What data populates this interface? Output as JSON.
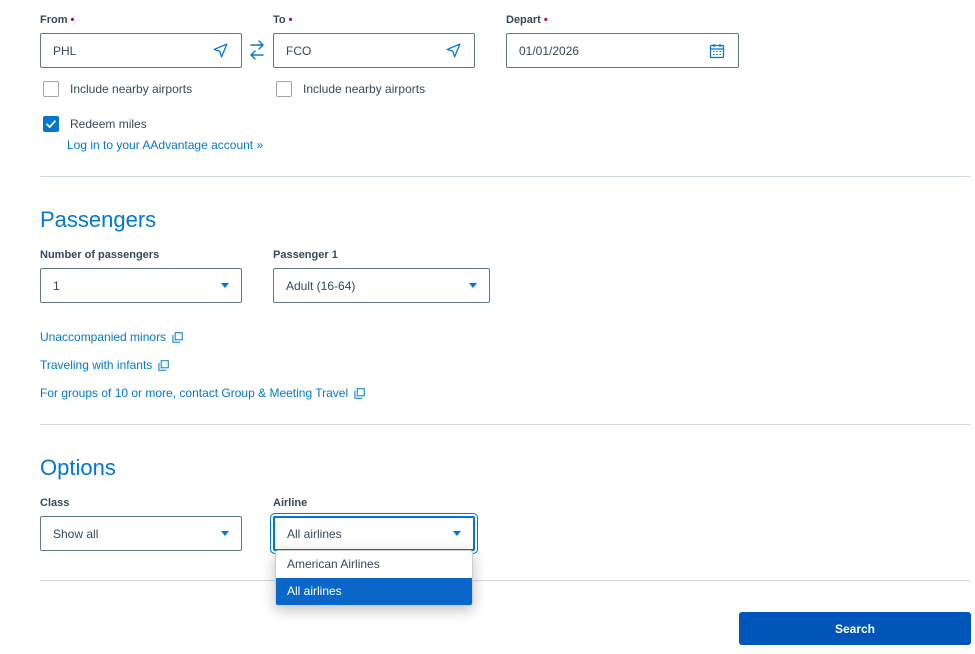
{
  "trip": {
    "from": {
      "label": "From",
      "value": "PHL",
      "nearby_label": "Include nearby airports",
      "nearby_checked": false
    },
    "to": {
      "label": "To",
      "value": "FCO",
      "nearby_label": "Include nearby airports",
      "nearby_checked": false
    },
    "depart": {
      "label": "Depart",
      "value": "01/01/2026"
    },
    "required_marker": "•",
    "redeem_miles": {
      "label": "Redeem miles",
      "checked": true
    },
    "login_link": "Log in to your AAdvantage account »"
  },
  "passengers": {
    "title": "Passengers",
    "number": {
      "label": "Number of passengers",
      "value": "1"
    },
    "passenger1": {
      "label": "Passenger 1",
      "value": "Adult (16-64)"
    },
    "links": [
      "Unaccompanied minors",
      "Traveling with infants",
      "For groups of 10 or more, contact Group & Meeting Travel"
    ]
  },
  "options": {
    "title": "Options",
    "class": {
      "label": "Class",
      "value": "Show all"
    },
    "airline": {
      "label": "Airline",
      "value": "All airlines",
      "options": [
        "American Airlines",
        "All airlines"
      ],
      "selected_index": 1
    }
  },
  "search_button": "Search",
  "colors": {
    "accent": "#0078d2",
    "button": "#0055b8",
    "required": "#c30019",
    "text": "#36495a"
  },
  "icons": {
    "airport_field": "location-arrow-icon",
    "date_field": "calendar-icon",
    "swap": "swap-arrows-icon",
    "external": "external-link-icon"
  }
}
